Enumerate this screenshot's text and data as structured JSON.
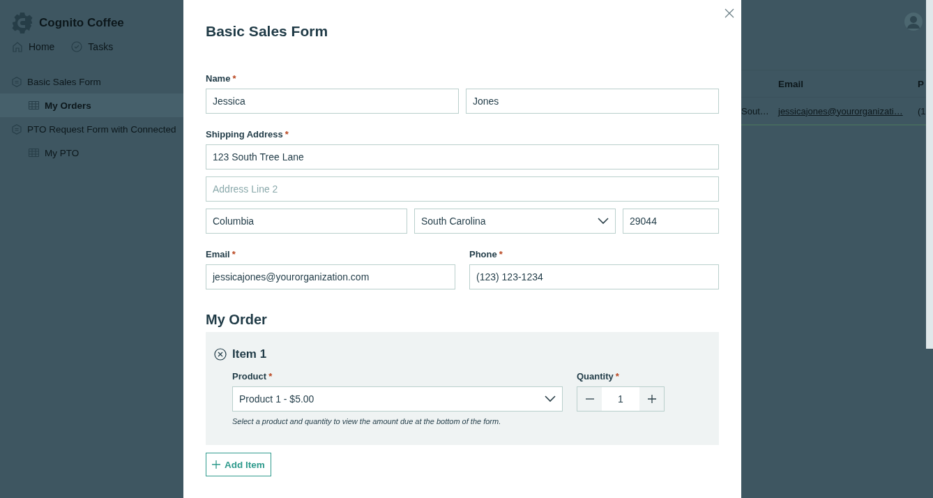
{
  "app": {
    "brand": "Cognito Coffee",
    "nav": [
      {
        "label": "Home"
      },
      {
        "label": "Tasks"
      }
    ],
    "sidebar": [
      {
        "label": "Basic Sales Form",
        "selected": false,
        "children": [
          {
            "label": "My Orders",
            "selected": true
          }
        ]
      },
      {
        "label": "PTO Request Form with Connected",
        "selected": false,
        "children": [
          {
            "label": "My PTO",
            "selected": false
          }
        ]
      }
    ],
    "table": {
      "headers": [
        "Email",
        "P"
      ],
      "rows": [
        {
          "cells": [
            "Sout…",
            "jessicajones@yourorganizati…",
            "(1"
          ]
        }
      ]
    }
  },
  "form": {
    "title": "Basic Sales Form",
    "name": {
      "label": "Name",
      "required": "*",
      "first": "Jessica",
      "last": "Jones"
    },
    "address": {
      "label": "Shipping Address",
      "required": "*",
      "line1": "123 South Tree Lane",
      "line2_placeholder": "Address Line 2",
      "city": "Columbia",
      "state": "South Carolina",
      "zip": "29044"
    },
    "email": {
      "label": "Email",
      "required": "*",
      "value": "jessicajones@yourorganization.com"
    },
    "phone": {
      "label": "Phone",
      "required": "*",
      "value": "(123) 123-1234"
    },
    "order": {
      "heading": "My Order",
      "items": [
        {
          "title": "Item 1",
          "product": {
            "label": "Product",
            "required": "*",
            "value": "Product 1 - $5.00"
          },
          "quantity": {
            "label": "Quantity",
            "required": "*",
            "value": "1"
          },
          "hint": "Select a product and quantity to view the amount due at the bottom of the form."
        }
      ],
      "add_button": "Add Item"
    }
  }
}
